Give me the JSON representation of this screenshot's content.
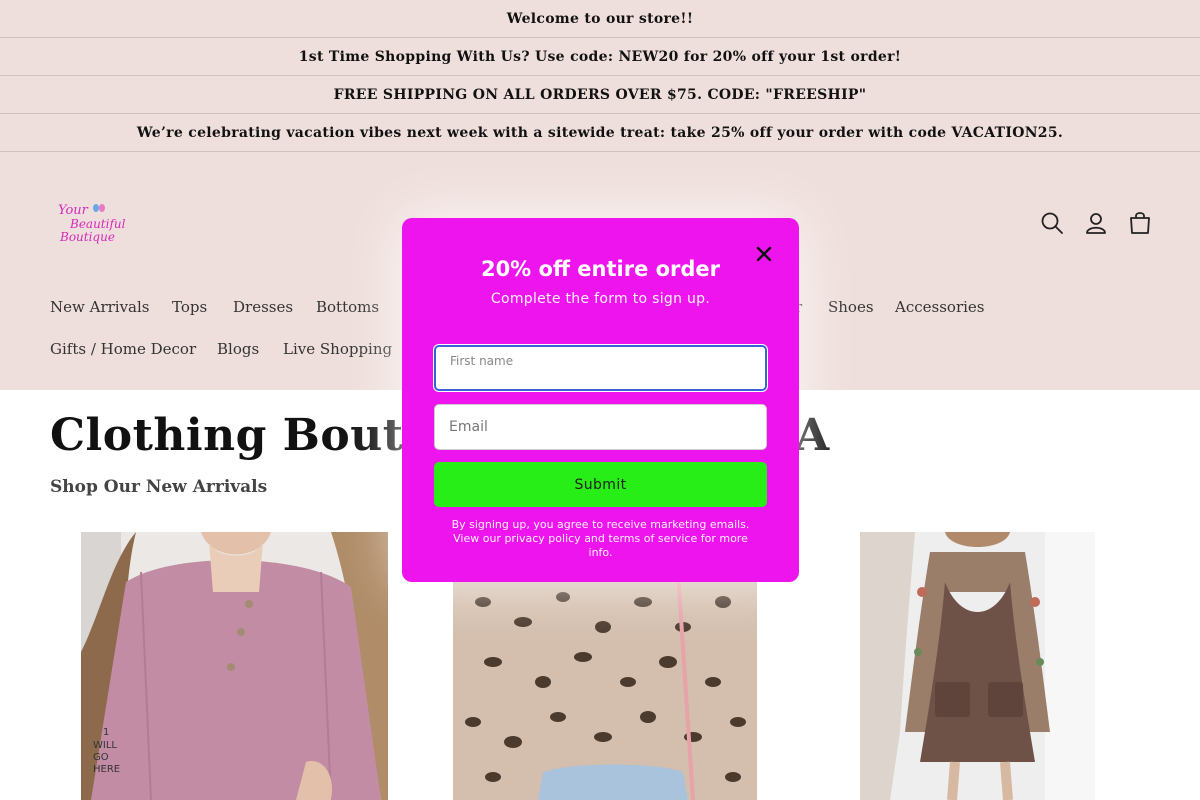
{
  "announcements": [
    "Welcome to our store!!",
    "1st Time Shopping With Us? Use code: NEW20 for 20% off your 1st order!",
    "FREE SHIPPING ON ALL ORDERS OVER $75. CODE: \"FREESHIP\"",
    "We’re celebrating vacation vibes next week with a sitewide treat: take 25% off your order with code VACATION25."
  ],
  "logo": {
    "line1": "Your",
    "line2": "Beautiful",
    "line3": "Boutique"
  },
  "header_icons": [
    "search-icon",
    "account-icon",
    "cart-icon"
  ],
  "nav": {
    "row1": [
      "New Arrivals",
      "Tops",
      "Dresses",
      "Bottoms",
      "r",
      "Shoes",
      "Accessories"
    ],
    "row2": [
      "Gifts / Home Decor",
      "Blogs",
      "Live Shopping"
    ]
  },
  "main": {
    "title_left": "Clothing Boutiq",
    "title_right": "A",
    "subtitle": "Shop Our New Arrivals"
  },
  "products": [
    {
      "image": "pink-ribbed-henley-top"
    },
    {
      "image": "leopard-print-sweater"
    },
    {
      "image": "floral-top-with-brown-pinafore-dress"
    }
  ],
  "modal": {
    "title": "20% off entire order",
    "subtitle": "Complete the form to sign up.",
    "first_name_label": "First name",
    "first_name_value": "",
    "email_placeholder": "Email",
    "email_value": "",
    "submit_label": "Submit",
    "disclaimer": "By signing up, you agree to receive marketing emails. View our privacy policy and terms of service for more info.",
    "background_color": "#ee14ee",
    "submit_color": "#26ee16"
  },
  "colors": {
    "header_bg": "#efdfdc",
    "focus_ring": "#3a63d8",
    "logo_pink": "#d42ab8"
  }
}
